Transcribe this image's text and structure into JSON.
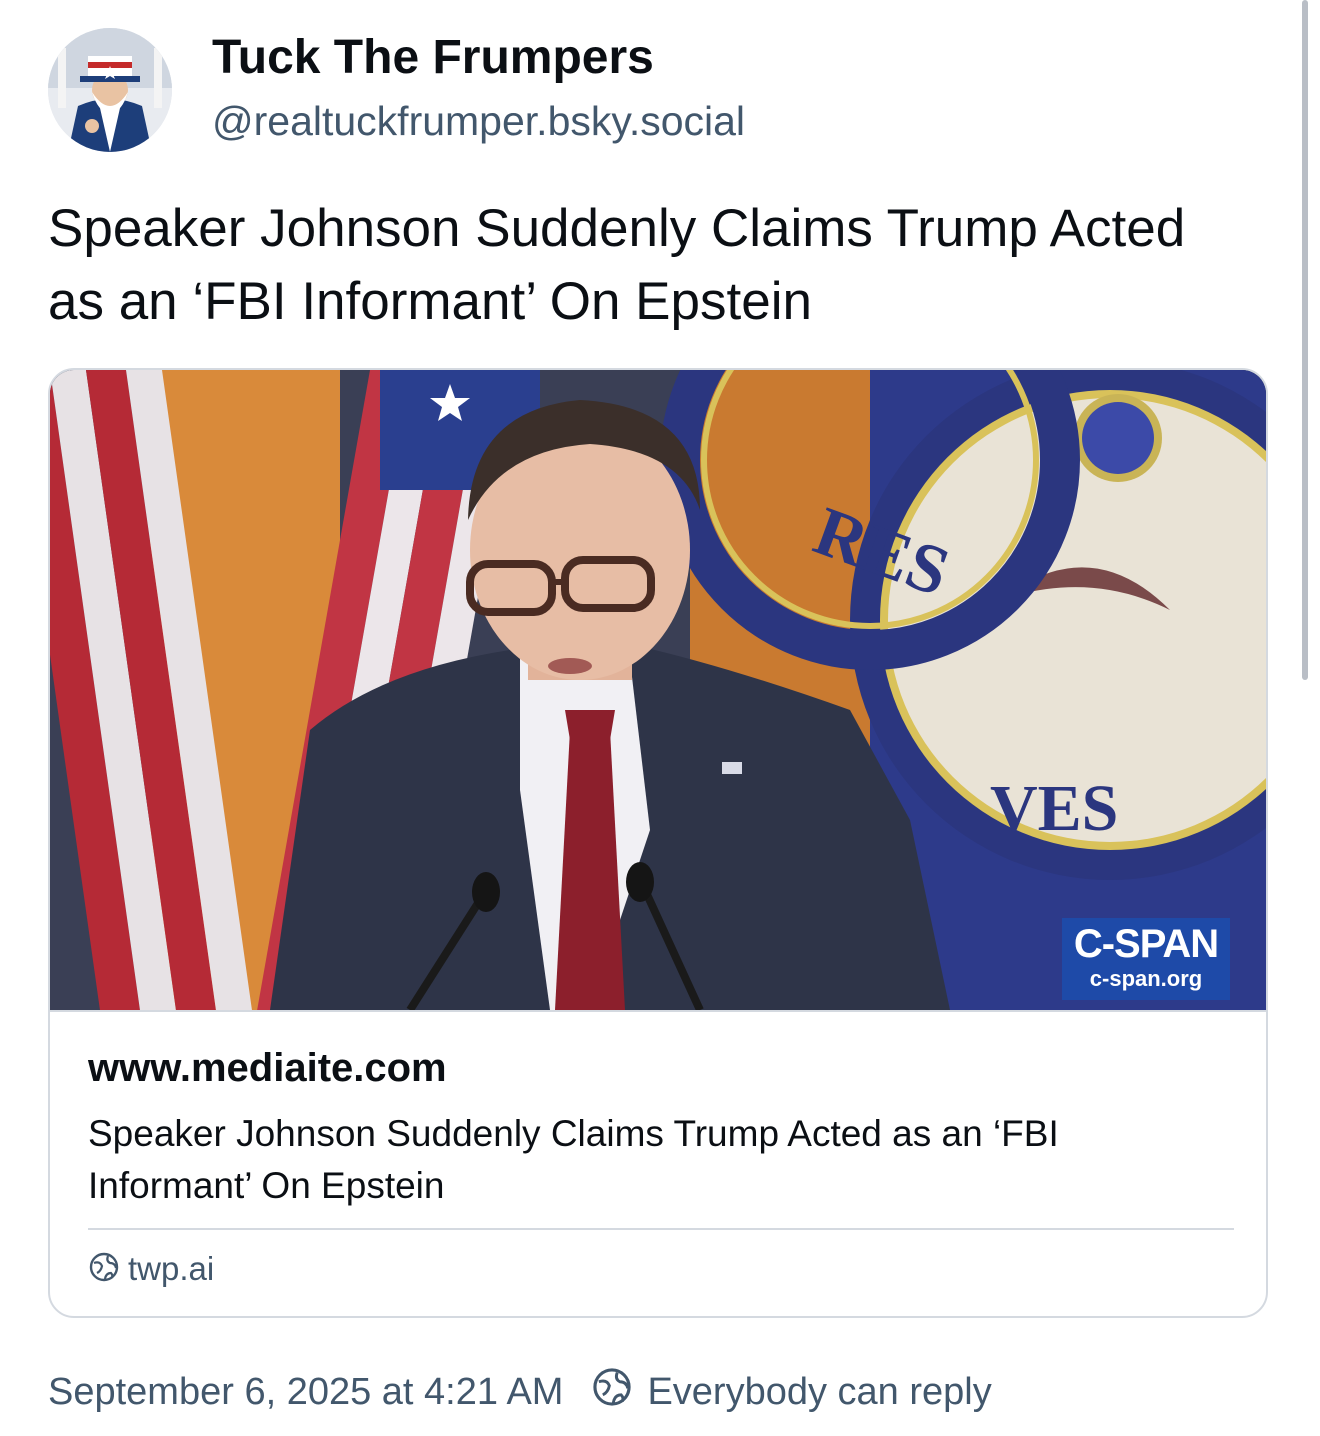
{
  "author": {
    "display_name": "Tuck The Frumpers",
    "handle": "@realtuckfrumper.bsky.social"
  },
  "post": {
    "text": "Speaker Johnson Suddenly Claims Trump Acted as an ‘FBI Informant’ On Epstein"
  },
  "link_card": {
    "image_watermark": {
      "brand": "C-SPAN",
      "url": "c-span.org"
    },
    "domain": "www.mediaite.com",
    "description": "Speaker Johnson Suddenly Claims Trump Acted as an ‘FBI Informant’ On Epstein",
    "source_icon": "globe-icon",
    "source": "twp.ai"
  },
  "footer": {
    "timestamp": "September 6, 2025 at 4:21 AM",
    "reply_icon": "globe-icon",
    "reply_setting": "Everybody can reply"
  },
  "colors": {
    "text_primary": "#0b0f14",
    "text_secondary": "#42576c",
    "border": "#d4d9e0",
    "watermark_blue": "#1e4aa8"
  }
}
